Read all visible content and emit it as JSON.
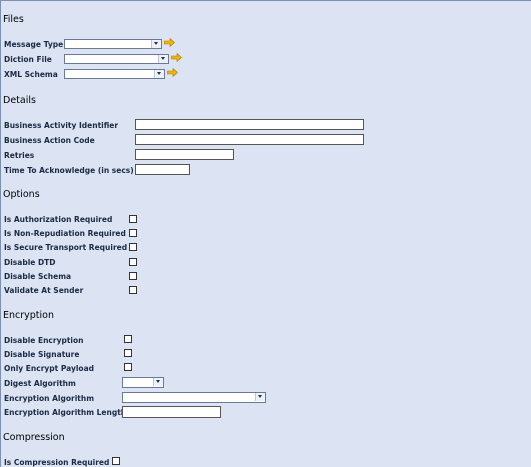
{
  "sections": {
    "files": "Files",
    "details": "Details",
    "options": "Options",
    "encryption": "Encryption",
    "compression": "Compression"
  },
  "files": {
    "message_type_label": "Message Type",
    "diction_file_label": "Diction File",
    "xml_schema_label": "XML Schema",
    "message_type_value": "",
    "diction_file_value": "",
    "xml_schema_value": ""
  },
  "details": {
    "business_activity_identifier_label": "Business Activity Identifier",
    "business_action_code_label": "Business Action Code",
    "retries_label": "Retries",
    "time_to_acknowledge_label": "Time To Acknowledge (in secs)",
    "business_activity_identifier_value": "",
    "business_action_code_value": "",
    "retries_value": "",
    "time_to_acknowledge_value": ""
  },
  "options": {
    "is_authorization_required_label": "Is Authorization Required",
    "is_non_repudiation_required_label": "Is Non-Repudiation Required",
    "is_secure_transport_required_label": "Is Secure Transport Required",
    "disable_dtd_label": "Disable DTD",
    "disable_schema_label": "Disable Schema",
    "validate_at_sender_label": "Validate At Sender",
    "is_authorization_required": false,
    "is_non_repudiation_required": false,
    "is_secure_transport_required": false,
    "disable_dtd": false,
    "disable_schema": false,
    "validate_at_sender": false
  },
  "encryption": {
    "disable_encryption_label": "Disable Encryption",
    "disable_signature_label": "Disable Signature",
    "only_encrypt_payload_label": "Only Encrypt Payload",
    "digest_algorithm_label": "Digest Algorithm",
    "encryption_algorithm_label": "Encryption Algorithm",
    "encryption_algorithm_length_label": "Encryption Algorithm Length",
    "disable_encryption": false,
    "disable_signature": false,
    "only_encrypt_payload": false,
    "digest_algorithm_value": "",
    "encryption_algorithm_value": "",
    "encryption_algorithm_length_value": ""
  },
  "compression": {
    "is_compression_required_label": "Is Compression Required",
    "is_compression_required": false
  },
  "icons": {
    "go": "arrow-right-icon",
    "go_color": "#f2b400"
  }
}
